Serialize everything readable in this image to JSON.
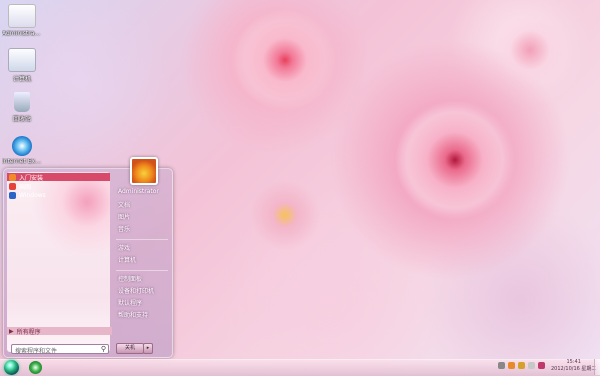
{
  "desktop": {
    "icons": [
      {
        "label": "Administrator",
        "icon": "user-folder-icon"
      },
      {
        "label": "计算机",
        "icon": "computer-icon"
      },
      {
        "label": "回收站",
        "icon": "recycle-bin-icon"
      },
      {
        "label": "Internet Explorer",
        "icon": "internet-explorer-icon"
      }
    ]
  },
  "start_menu": {
    "programs": [
      {
        "label": "入门安装",
        "icon": "getting-started-icon"
      },
      {
        "label": "画图",
        "icon": "paint-icon"
      },
      {
        "label": "Windows",
        "icon": "windows-media-icon"
      }
    ],
    "all_programs": "所有程序",
    "search_placeholder": "搜索程序和文件",
    "right_items": [
      "Administrator",
      "文档",
      "图片",
      "音乐",
      "游戏",
      "计算机",
      "控制面板",
      "设备和打印机",
      "默认程序",
      "帮助和支持"
    ],
    "shutdown": "关机"
  },
  "taskbar": {
    "clock_time": "15:41",
    "clock_date": "2012/10/16 星期二"
  },
  "colors": {
    "accent": "#d84a6a",
    "wallpaper": "#f4c2d6"
  }
}
